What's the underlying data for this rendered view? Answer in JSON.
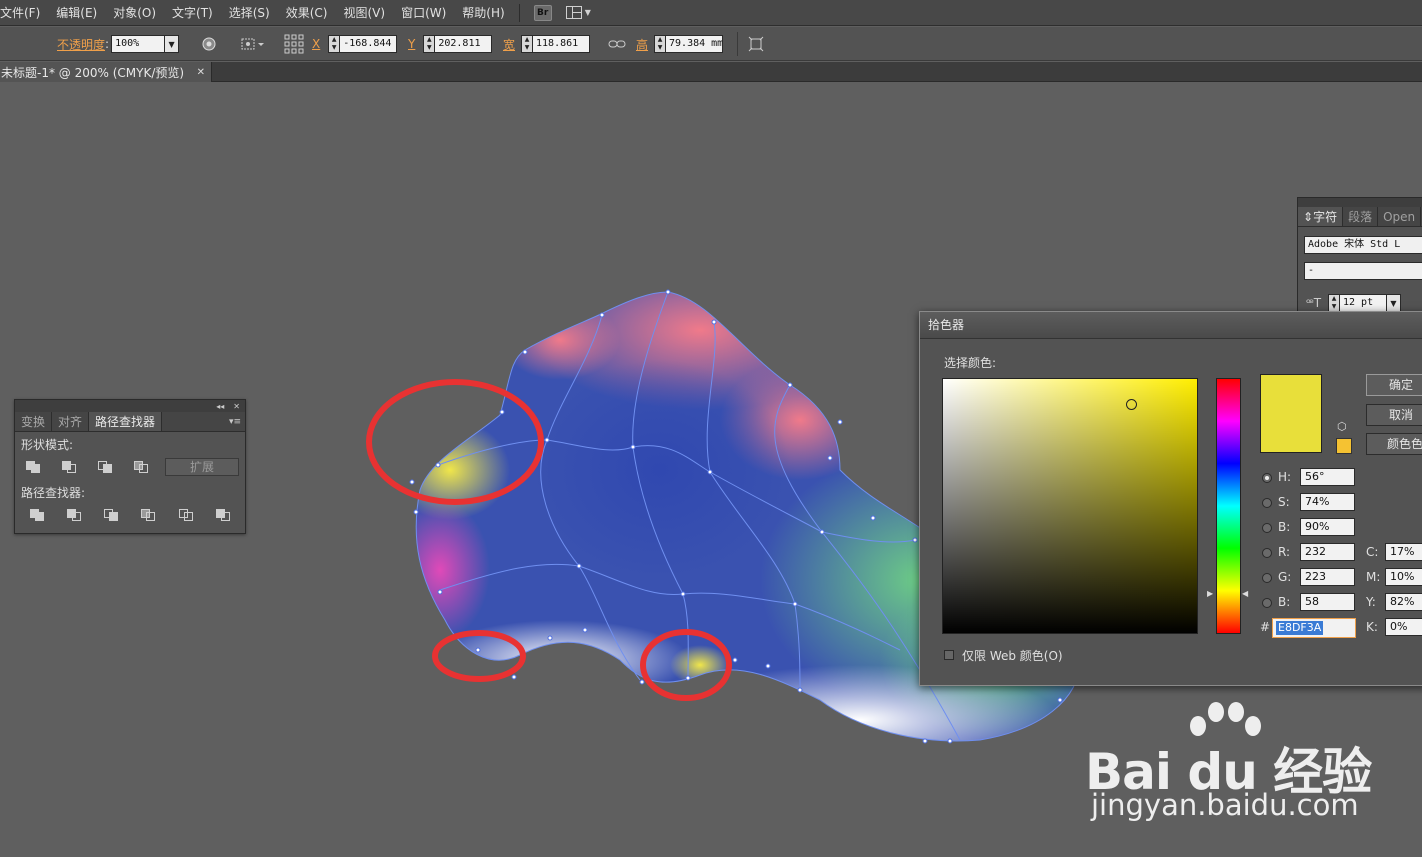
{
  "menu": {
    "items": [
      "文件(F)",
      "编辑(E)",
      "对象(O)",
      "文字(T)",
      "选择(S)",
      "效果(C)",
      "视图(V)",
      "窗口(W)",
      "帮助(H)"
    ],
    "bridge_label": "Br"
  },
  "control": {
    "opacity_label": "不透明度",
    "opacity_value": "100%",
    "x_label": "X",
    "x_value": "-168.844",
    "y_label": "Y",
    "y_value": "202.811",
    "w_label": "宽",
    "w_value": "118.861",
    "h_label": "高",
    "h_value": "79.384 mm"
  },
  "document": {
    "tab_title": "未标题-1* @ 200% (CMYK/预览)"
  },
  "pathfinder_panel": {
    "tabs": [
      "变换",
      "对齐",
      "路径查找器"
    ],
    "active_tab": 2,
    "shape_modes_label": "形状模式:",
    "expand_label": "扩展",
    "pathfinders_label": "路径查找器:"
  },
  "character_panel": {
    "tabs": [
      "字符",
      "段落",
      "Open"
    ],
    "font_family": "Adobe 宋体 Std L",
    "font_style": "-",
    "font_size": "12 pt"
  },
  "color_picker": {
    "title": "拾色器",
    "select_label": "选择颜色:",
    "current_color": "#E8DF3A",
    "gamut_color": "#F5C232",
    "buttons": [
      "确定",
      "取消",
      "颜色色板"
    ],
    "hsb": [
      {
        "label": "H:",
        "value": "56°",
        "selected": true
      },
      {
        "label": "S:",
        "value": "74%",
        "selected": false
      },
      {
        "label": "B:",
        "value": "90%",
        "selected": false
      }
    ],
    "rgb": [
      {
        "label": "R:",
        "value": "232"
      },
      {
        "label": "G:",
        "value": "223"
      },
      {
        "label": "B:",
        "value": "58"
      }
    ],
    "cmyk": [
      {
        "label": "C:",
        "value": "17%"
      },
      {
        "label": "M:",
        "value": "10%"
      },
      {
        "label": "Y:",
        "value": "82%"
      },
      {
        "label": "K:",
        "value": "0%"
      }
    ],
    "hex_label": "#",
    "hex_value": "E8DF3A",
    "web_only_label": "仅限 Web 颜色(O)"
  },
  "watermark": {
    "logo_text": "Bai du 经验",
    "url": "jingyan.baidu.com"
  }
}
